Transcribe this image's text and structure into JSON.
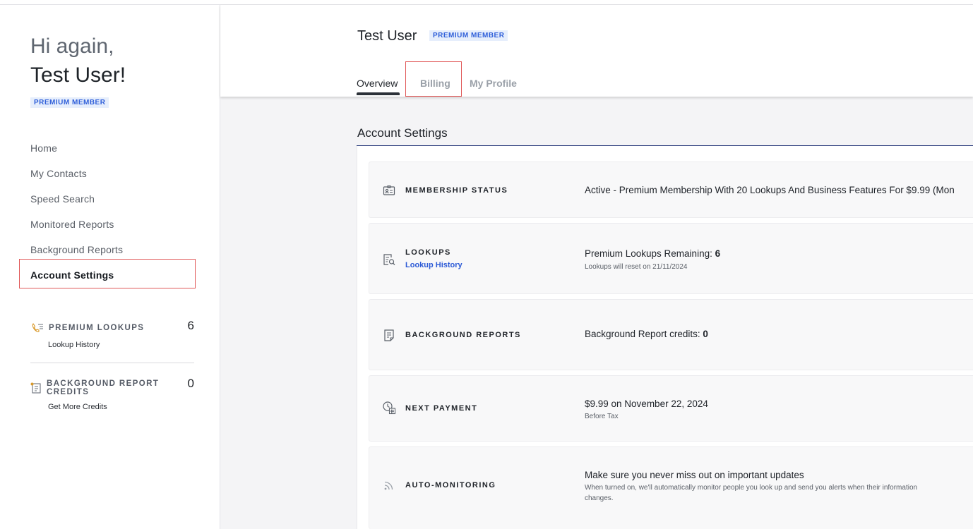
{
  "sidebar": {
    "greeting_line1": "Hi again,",
    "greeting_line2": "Test User!",
    "badge": "PREMIUM MEMBER",
    "nav": [
      {
        "label": "Home"
      },
      {
        "label": "My Contacts"
      },
      {
        "label": "Speed Search"
      },
      {
        "label": "Monitored Reports"
      },
      {
        "label": "Background Reports"
      },
      {
        "label": "Account Settings",
        "active": true
      }
    ],
    "premium_lookups": {
      "label": "PREMIUM LOOKUPS",
      "value": "6",
      "link": "Lookup History"
    },
    "report_credits": {
      "label": "BACKGROUND REPORT CREDITS",
      "value": "0",
      "link": "Get More Credits"
    }
  },
  "header": {
    "user_name": "Test User",
    "badge": "PREMIUM MEMBER",
    "tabs": [
      {
        "label": "Overview",
        "active": true
      },
      {
        "label": "Billing"
      },
      {
        "label": "My Profile"
      }
    ]
  },
  "main": {
    "title": "Account Settings",
    "membership": {
      "label": "MEMBERSHIP STATUS",
      "value": "Active - Premium Membership With 20 Lookups And Business Features For $9.99 (Mon"
    },
    "lookups": {
      "label": "LOOKUPS",
      "link": "Lookup History",
      "value_prefix": "Premium Lookups Remaining:",
      "value": "6",
      "note": "Lookups will reset on 21/11/2024"
    },
    "background_reports": {
      "label": "BACKGROUND REPORTS",
      "value_prefix": "Background Report credits:",
      "value": "0"
    },
    "next_payment": {
      "label": "NEXT PAYMENT",
      "value": "$9.99 on November 22, 2024",
      "note": "Before Tax"
    },
    "auto_monitoring": {
      "label": "AUTO-MONITORING",
      "value": "Make sure you never miss out on important updates",
      "note_line1": "When turned on, we'll automatically monitor people you look up and send you alerts when their information",
      "note_line2": "changes."
    }
  },
  "colors": {
    "accent": "#2c5ad6",
    "badge_bg": "#e6eefc",
    "highlight_box": "#e05858",
    "title_rule": "#283a7a"
  },
  "icons": {
    "membership": "id-card-icon",
    "lookups": "document-search-icon",
    "background_reports": "report-icon",
    "next_payment": "calendar-clock-icon",
    "auto_monitoring": "rss-icon",
    "premium_lookups": "phone-list-icon",
    "report_credits": "report-credit-icon"
  }
}
